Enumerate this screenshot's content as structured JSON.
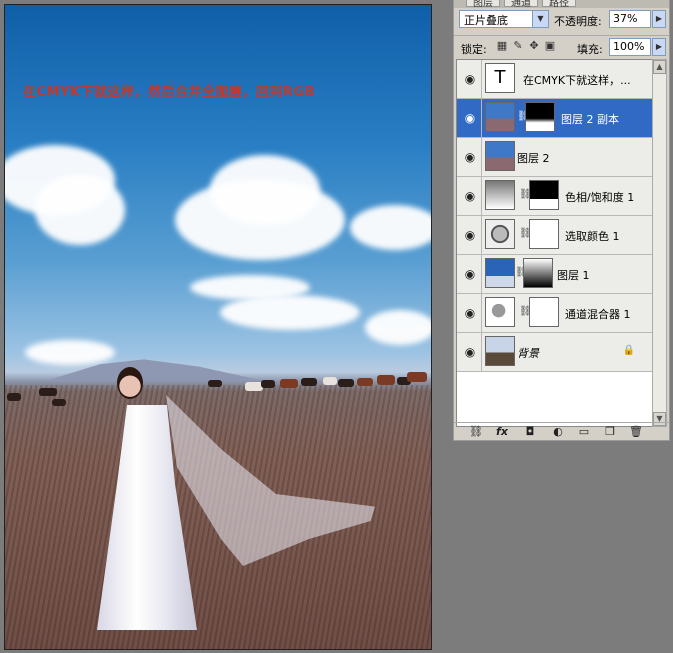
{
  "canvas": {
    "note": "在CMYK下就这样，然后合并全图层，回到RGB"
  },
  "panel": {
    "tabs": [
      "图层",
      "通道",
      "路径"
    ],
    "blend_mode": "正片叠底",
    "opacity_label": "不透明度:",
    "opacity_value": "37%",
    "lock_label": "锁定:",
    "fill_label": "填充:",
    "fill_value": "100%",
    "layers": [
      {
        "name": "在CMYK下就这样，...",
        "type": "text",
        "thumb_glyph": "T"
      },
      {
        "name": "图层 2 副本",
        "type": "image-mask",
        "selected": true
      },
      {
        "name": "图层 2",
        "type": "image"
      },
      {
        "name": "色相/饱和度 1",
        "type": "adjustment-mask"
      },
      {
        "name": "选取颜色 1",
        "type": "adjustment-mask"
      },
      {
        "name": "图层 1",
        "type": "image-mask"
      },
      {
        "name": "通道混合器 1",
        "type": "adjustment-mask"
      },
      {
        "name": "背景",
        "type": "background",
        "locked": true
      }
    ]
  },
  "colors": {
    "selection": "#316ac5",
    "panel_bg": "#d4d0c8",
    "workspace_bg": "#7c7c7c",
    "note_text": "#c0392b"
  }
}
